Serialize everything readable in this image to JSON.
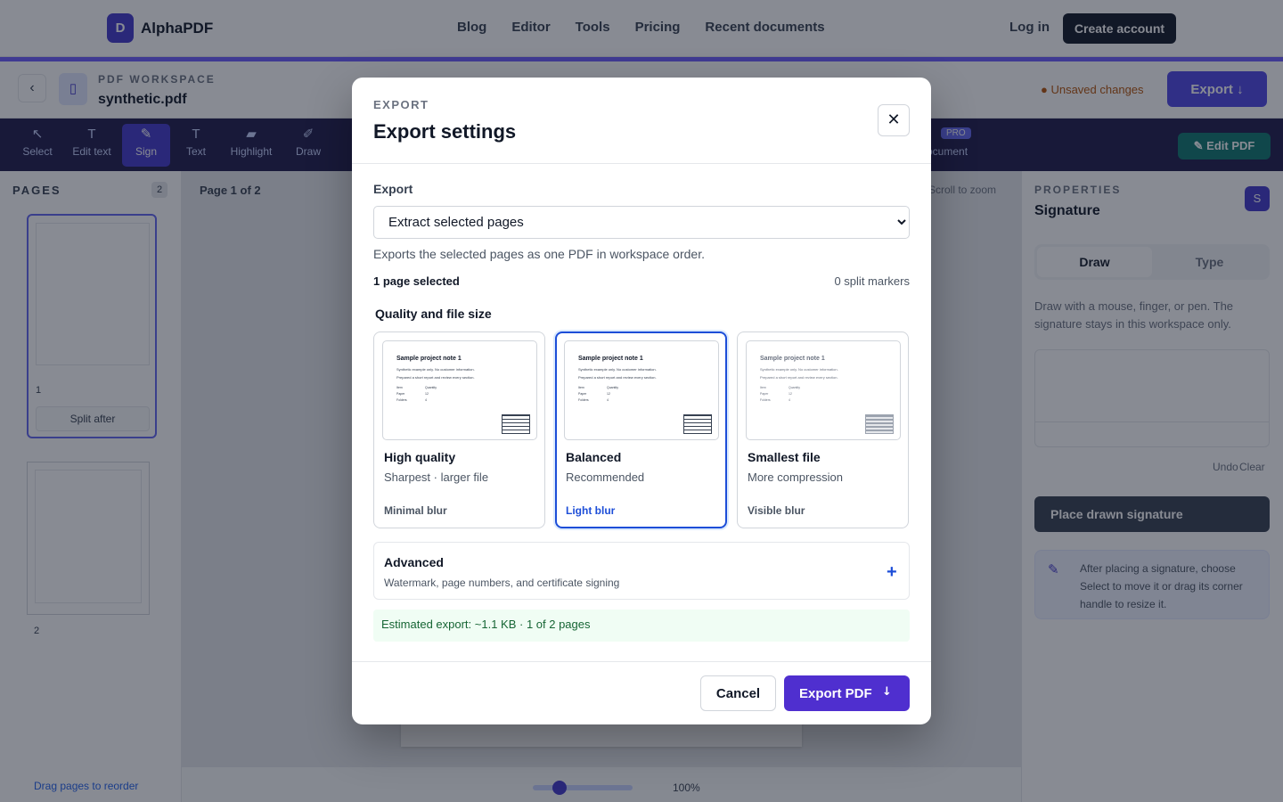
{
  "app": {
    "brand_mark": "D",
    "brand_name": "AlphaPDF",
    "nav": [
      "Blog",
      "Editor",
      "Tools",
      "Pricing",
      "Recent documents"
    ],
    "login": "Log in",
    "create_account": "Create account"
  },
  "workspace": {
    "back_glyph": "‹",
    "doc_glyph": "▯",
    "kicker": "PDF WORKSPACE",
    "filename": "synthetic.pdf",
    "unsaved": "● Unsaved changes",
    "export_button": "Export ↓"
  },
  "toolbar": {
    "tools": [
      {
        "label": "Select",
        "glyph": "↖"
      },
      {
        "label": "Edit text",
        "glyph": "T"
      },
      {
        "label": "Sign",
        "glyph": "✎"
      },
      {
        "label": "Text",
        "glyph": "T"
      },
      {
        "label": "Highlight",
        "glyph": "▰"
      },
      {
        "label": "Draw",
        "glyph": "✐"
      }
    ],
    "pro_tag": "PRO",
    "partial_label": "ocument",
    "edit_pdf": "✎ Edit PDF"
  },
  "pages_panel": {
    "title": "PAGES",
    "count": "2",
    "thumb1_num": "1",
    "thumb2_num": "2",
    "split_after": "Split after",
    "hint": "Drag pages to reorder"
  },
  "canvas": {
    "page_label": "Page 1 of 2",
    "right_label": "Scroll to zoom",
    "zoom": "100%"
  },
  "properties": {
    "kicker": "PROPERTIES",
    "title": "Signature",
    "badge": "S",
    "tabs": [
      "Draw",
      "Type"
    ],
    "description": "Draw with a mouse, finger, or pen. The signature stays in this workspace only.",
    "undo": "Undo",
    "clear": "Clear",
    "place_button": "Place drawn signature",
    "tip": "After placing a signature, choose Select to move it or drag its corner handle to resize it."
  },
  "modal": {
    "kicker": "EXPORT",
    "title": "Export settings",
    "close_glyph": "✕",
    "export_label": "Export",
    "export_mode": "Extract selected pages",
    "export_options": [
      "Extract selected pages"
    ],
    "help": "Exports the selected pages as one PDF in workspace order.",
    "selected_count": "1 page selected",
    "split_markers": "0 split markers",
    "quality_title": "Quality and file size",
    "quality_options": [
      {
        "name": "High quality",
        "subtitle": "Sharpest · larger file",
        "blur": "Minimal blur",
        "selected": false
      },
      {
        "name": "Balanced",
        "subtitle": "Recommended",
        "blur": "Light blur",
        "selected": true
      },
      {
        "name": "Smallest file",
        "subtitle": "More compression",
        "blur": "Visible blur",
        "selected": false
      }
    ],
    "preview": {
      "title": "Sample project note 1",
      "line1": "Synthetic example only. No customer information.",
      "line2": "Prepared a short report and review every section.",
      "rows": [
        {
          "label": "Item",
          "value": "Quantity"
        },
        {
          "label": "Paper",
          "value": "12"
        },
        {
          "label": "Folders",
          "value": "4"
        }
      ]
    },
    "advanced_title": "Advanced",
    "advanced_sub": "Watermark, page numbers, and certificate signing",
    "advanced_glyph": "+",
    "estimate": "Estimated export: ~1.1 KB · 1 of 2 pages",
    "cancel": "Cancel",
    "export_pdf": "Export PDF",
    "export_arrow": "↓"
  },
  "colors": {
    "accent": "#4f2fcf",
    "selected_border": "#1d4ed8",
    "estimate_bg": "#f0fdf4"
  }
}
